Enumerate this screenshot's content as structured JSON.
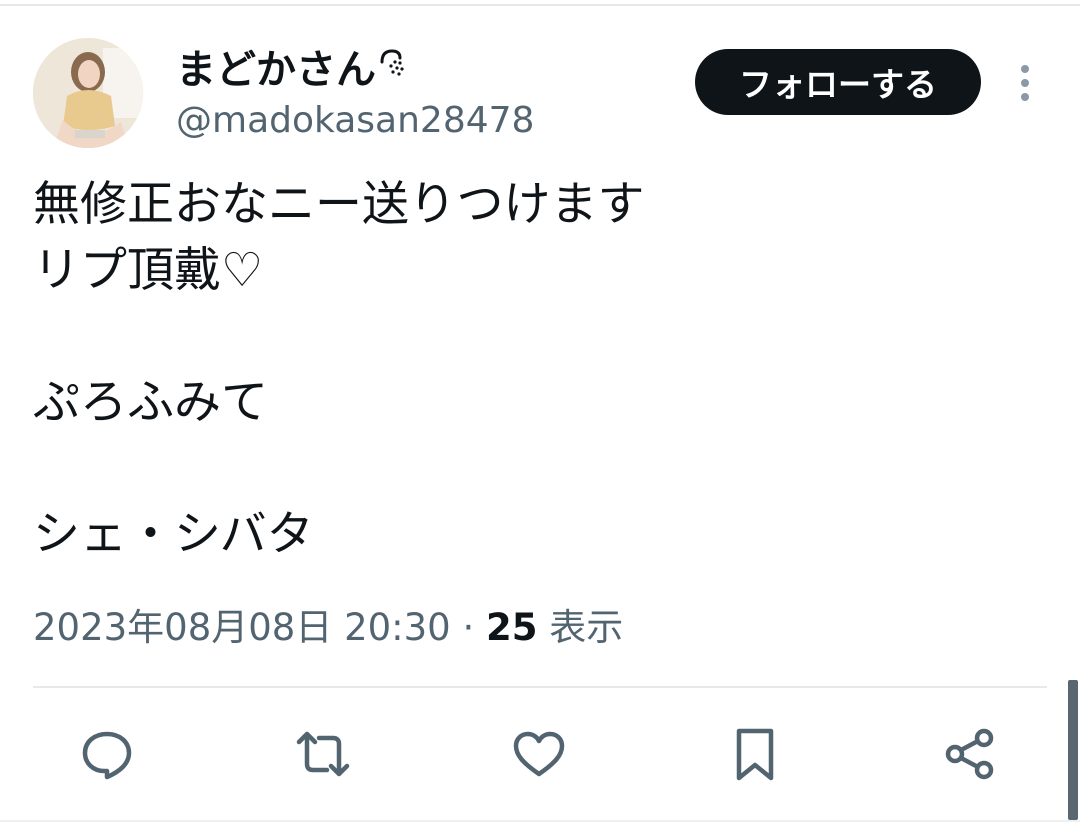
{
  "post": {
    "author": {
      "display_name": "まどかさん",
      "handle": "@madokasan28478",
      "avatar_icon": "profile-photo"
    },
    "follow_label": "フォローする",
    "more_icon": "more-vertical-icon",
    "text_lines": [
      "無修正おなニー送りつけます",
      "リプ頂戴♡",
      "",
      "ぷろふみて",
      "",
      "シェ・シバタ"
    ],
    "timestamp": "2023年08月08日 20:30",
    "separator": "·",
    "views_count": "25",
    "views_label": "表示"
  },
  "actions": [
    "reply-icon",
    "repost-icon",
    "like-icon",
    "bookmark-icon",
    "share-icon"
  ],
  "colors": {
    "text_primary": "#0f1419",
    "text_secondary": "#536471",
    "button_bg": "#0f1419",
    "button_text": "#ffffff",
    "divider": "#e6e9eb"
  }
}
